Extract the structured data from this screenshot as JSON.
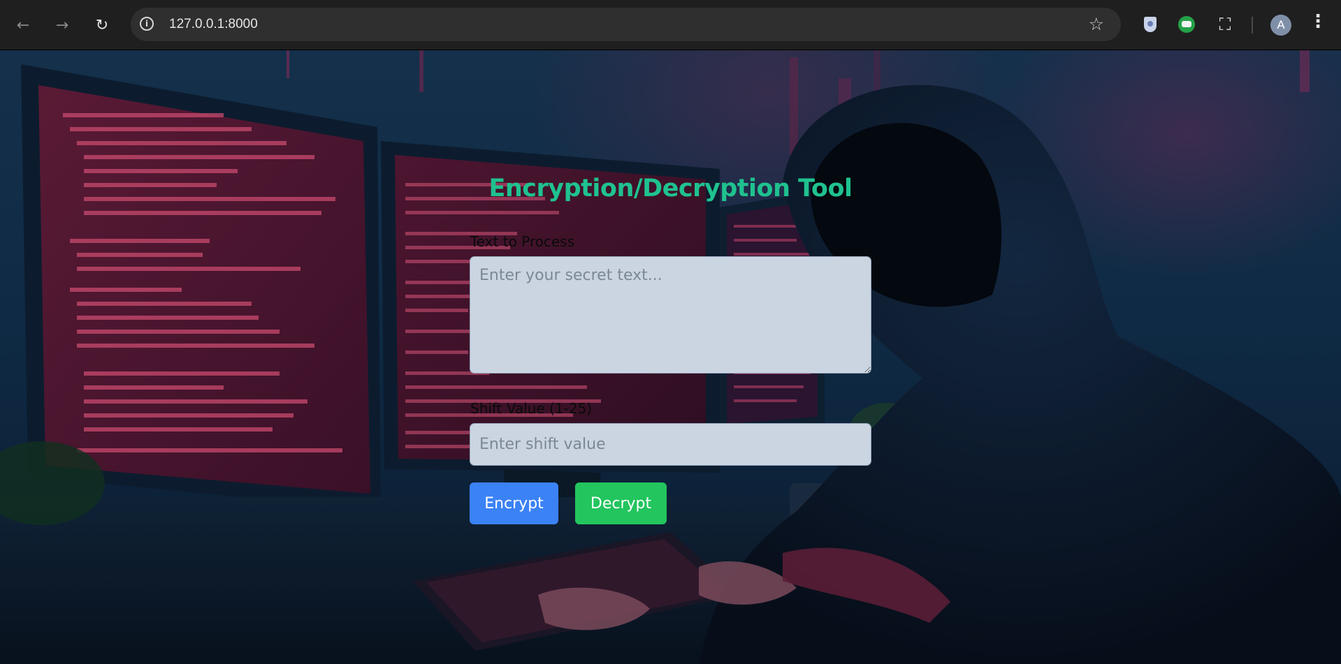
{
  "browser": {
    "url": "127.0.0.1:8000",
    "back_icon": "arrow-left-icon",
    "forward_icon": "arrow-right-icon",
    "reload_icon": "reload-icon",
    "avatar_letter": "A"
  },
  "app": {
    "title": "Encryption/Decryption Tool",
    "title_color": "#1fc28f",
    "text_label": "Text to Process",
    "text_placeholder": "Enter your secret text...",
    "shift_label": "Shift Value (1-25)",
    "shift_placeholder": "Enter shift value",
    "encrypt_label": "Encrypt",
    "decrypt_label": "Decrypt",
    "encrypt_color": "#3b82f6",
    "decrypt_color": "#22c55e"
  }
}
